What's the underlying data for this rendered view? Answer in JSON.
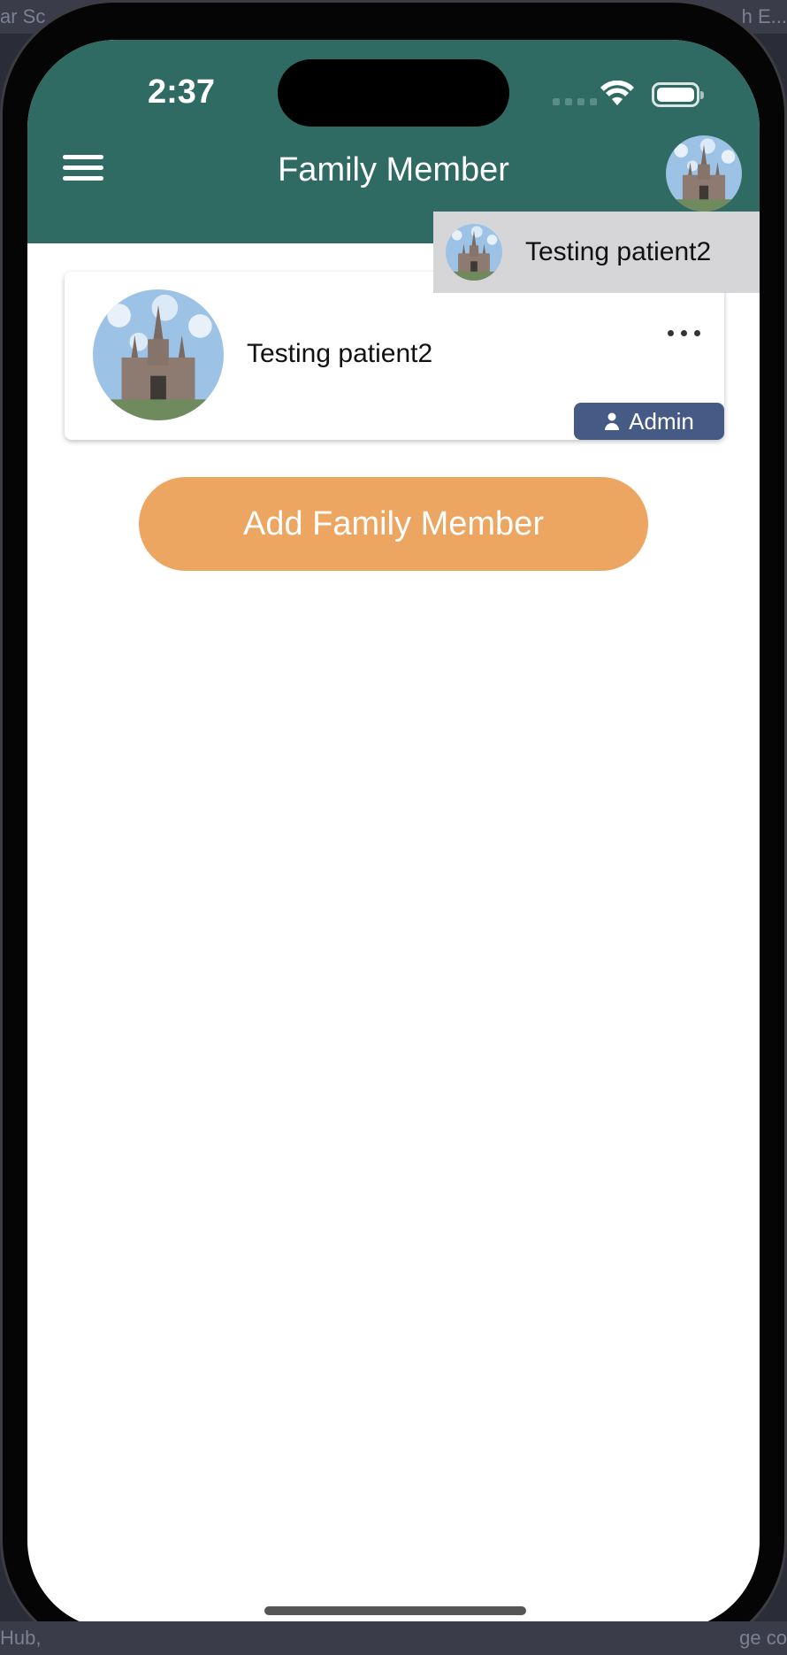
{
  "desktop": {
    "top_left": "ar Sc",
    "top_right": "h E...",
    "bottom_left": "Hub,",
    "bottom_right": "ge co"
  },
  "status_bar": {
    "time": "2:37"
  },
  "header": {
    "title": "Family Member",
    "menu_icon": "hamburger-menu-icon",
    "avatar_icon": "user-avatar"
  },
  "dropdown": {
    "items": [
      {
        "name": "Testing patient2"
      }
    ]
  },
  "members": [
    {
      "name": "Testing patient2",
      "role": "Admin",
      "more_icon": "ellipsis-icon"
    }
  ],
  "actions": {
    "add_label": "Add Family Member"
  },
  "colors": {
    "header": "#2f6a63",
    "accent_button": "#eca662",
    "badge": "#465a86",
    "dropdown_bg": "#d6d6d9"
  }
}
